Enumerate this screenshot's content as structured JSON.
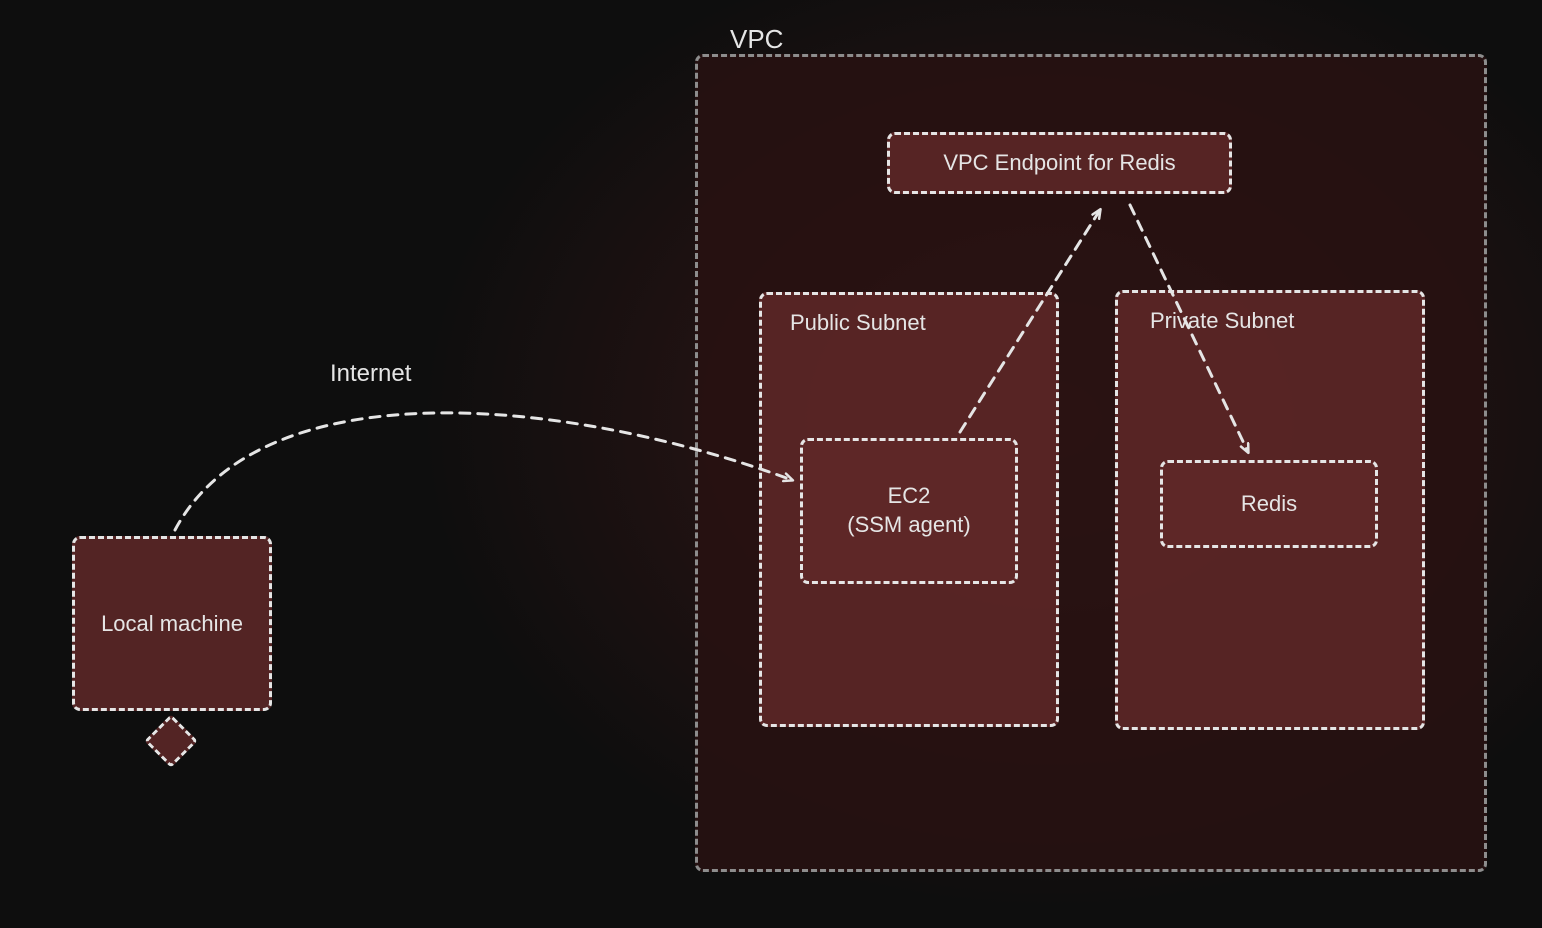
{
  "diagram": {
    "localMachine": "Local machine",
    "internet": "Internet",
    "vpc": {
      "label": "VPC",
      "vpcEndpoint": "VPC Endpoint for Redis",
      "publicSubnet": {
        "label": "Public Subnet",
        "ec2": "EC2\n(SSM agent)"
      },
      "privateSubnet": {
        "label": "Private Subnet",
        "redis": "Redis"
      }
    }
  },
  "style": {
    "stroke": "#e5e5e5",
    "dash": "10 8"
  }
}
